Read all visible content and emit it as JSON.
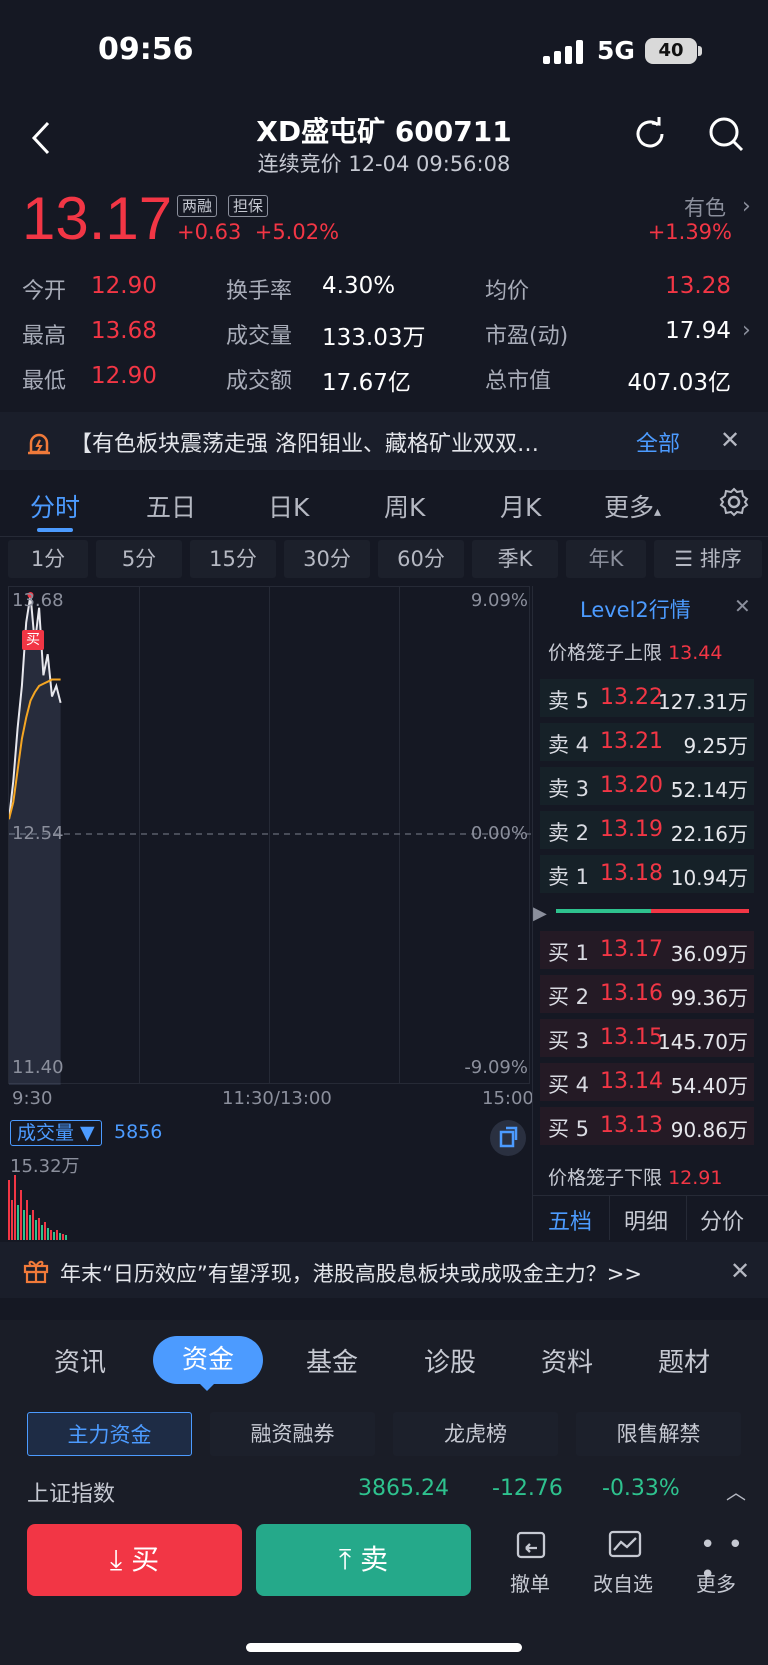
{
  "status": {
    "time": "09:56",
    "network": "5G",
    "battery": "40"
  },
  "header": {
    "title": "XD盛屯矿 600711",
    "subtitle": "连续竞价 12-04 09:56:08"
  },
  "quote": {
    "price": "13.17",
    "tag1": "两融",
    "tag2": "担保",
    "change": "+0.63",
    "change_pct": "+5.02%",
    "sector_name": "有色",
    "sector_pct": "+1.39%"
  },
  "stats": {
    "open_label": "今开",
    "open": "12.90",
    "high_label": "最高",
    "high": "13.68",
    "low_label": "最低",
    "low": "12.90",
    "turnover_label": "换手率",
    "turnover": "4.30%",
    "volume_label": "成交量",
    "volume": "133.03万",
    "amount_label": "成交额",
    "amount": "17.67亿",
    "avg_label": "均价",
    "avg": "13.28",
    "pe_label": "市盈(动)",
    "pe": "17.94",
    "mcap_label": "总市值",
    "mcap": "407.03亿"
  },
  "news": {
    "text": "【有色板块震荡走强 洛阳钼业、藏格矿业双双…",
    "all": "全部"
  },
  "tabs": [
    "分时",
    "五日",
    "日K",
    "周K",
    "月K",
    "更多"
  ],
  "subtabs": [
    "1分",
    "5分",
    "15分",
    "30分",
    "60分",
    "季K",
    "年K",
    "排序"
  ],
  "chart": {
    "y_top": "13.68",
    "y_mid": "12.54",
    "y_bot": "11.40",
    "pct_top": "9.09%",
    "pct_mid": "0.00%",
    "pct_bot": "-9.09%",
    "x_start": "9:30",
    "x_mid": "11:30/13:00",
    "x_end": "15:00",
    "buy_marker": "买",
    "volume_label": "成交量",
    "volume_value": "5856",
    "volume_max": "15.32万"
  },
  "chart_data": {
    "type": "line",
    "ylim": [
      11.4,
      13.68
    ],
    "series": [
      {
        "values": [
          12.62,
          12.8,
          13.05,
          13.25,
          13.55,
          13.68,
          13.45,
          13.62,
          13.3,
          13.4,
          13.2,
          13.25,
          13.17
        ]
      },
      {
        "values": [
          12.62,
          12.7,
          12.85,
          13.0,
          13.1,
          13.18,
          13.22,
          13.25,
          13.26,
          13.27,
          13.28,
          13.28,
          13.28
        ]
      }
    ]
  },
  "level2": {
    "title": "Level2行情",
    "upper_limit_label": "价格笼子上限",
    "upper_limit": "13.44",
    "lower_limit_label": "价格笼子下限",
    "lower_limit": "12.91",
    "asks": [
      {
        "label": "卖 5",
        "price": "13.22",
        "vol": "127.31万"
      },
      {
        "label": "卖 4",
        "price": "13.21",
        "vol": "9.25万"
      },
      {
        "label": "卖 3",
        "price": "13.20",
        "vol": "52.14万"
      },
      {
        "label": "卖 2",
        "price": "13.19",
        "vol": "22.16万"
      },
      {
        "label": "卖 1",
        "price": "13.18",
        "vol": "10.94万"
      }
    ],
    "bids": [
      {
        "label": "买 1",
        "price": "13.17",
        "vol": "36.09万"
      },
      {
        "label": "买 2",
        "price": "13.16",
        "vol": "99.36万"
      },
      {
        "label": "买 3",
        "price": "13.15",
        "vol": "145.70万"
      },
      {
        "label": "买 4",
        "price": "13.14",
        "vol": "54.40万"
      },
      {
        "label": "买 5",
        "price": "13.13",
        "vol": "90.86万"
      }
    ],
    "tabs": [
      "五档",
      "明细",
      "分价"
    ]
  },
  "promo": {
    "text": "年末“日历效应”有望浮现，港股高股息板块或成吸金主力？>>"
  },
  "sections": [
    "资讯",
    "资金",
    "基金",
    "诊股",
    "资料",
    "题材"
  ],
  "fund_tabs": [
    "主力资金",
    "融资融券",
    "龙虎榜",
    "限售解禁"
  ],
  "index": {
    "name": "上证指数",
    "value": "3865.24",
    "change": "-12.76",
    "pct": "-0.33%"
  },
  "actions": {
    "buy": "买",
    "sell": "卖",
    "cancel": "撤单",
    "watchlist": "改自选",
    "more": "更多"
  }
}
